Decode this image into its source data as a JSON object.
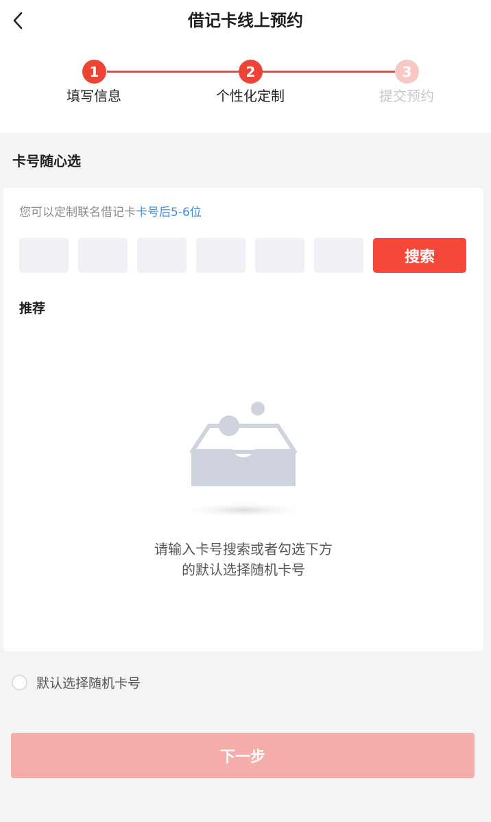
{
  "header": {
    "title": "借记卡线上预约",
    "back_icon": "chevron-left-icon"
  },
  "stepper": {
    "steps": [
      {
        "number": "1",
        "label": "填写信息",
        "state": "done"
      },
      {
        "number": "2",
        "label": "个性化定制",
        "state": "active"
      },
      {
        "number": "3",
        "label": "提交预约",
        "state": "pending"
      }
    ],
    "accent_color": "#ee4435",
    "pending_color": "#f8c9c4"
  },
  "section": {
    "title": "卡号随心选"
  },
  "card": {
    "hint_prefix": "您可以定制联名借记卡",
    "hint_highlight": "卡号后5-6位",
    "digit_inputs": [
      "",
      "",
      "",
      "",
      "",
      ""
    ],
    "search_label": "搜索",
    "recommend_title": "推荐",
    "empty_icon": "empty-inbox-icon",
    "empty_line1": "请输入卡号搜索或者勾选下方",
    "empty_line2": "的默认选择随机卡号"
  },
  "random_option": {
    "label": "默认选择随机卡号",
    "checked": false
  },
  "footer": {
    "next_label": "下一步",
    "next_color": "#f4ada9"
  }
}
